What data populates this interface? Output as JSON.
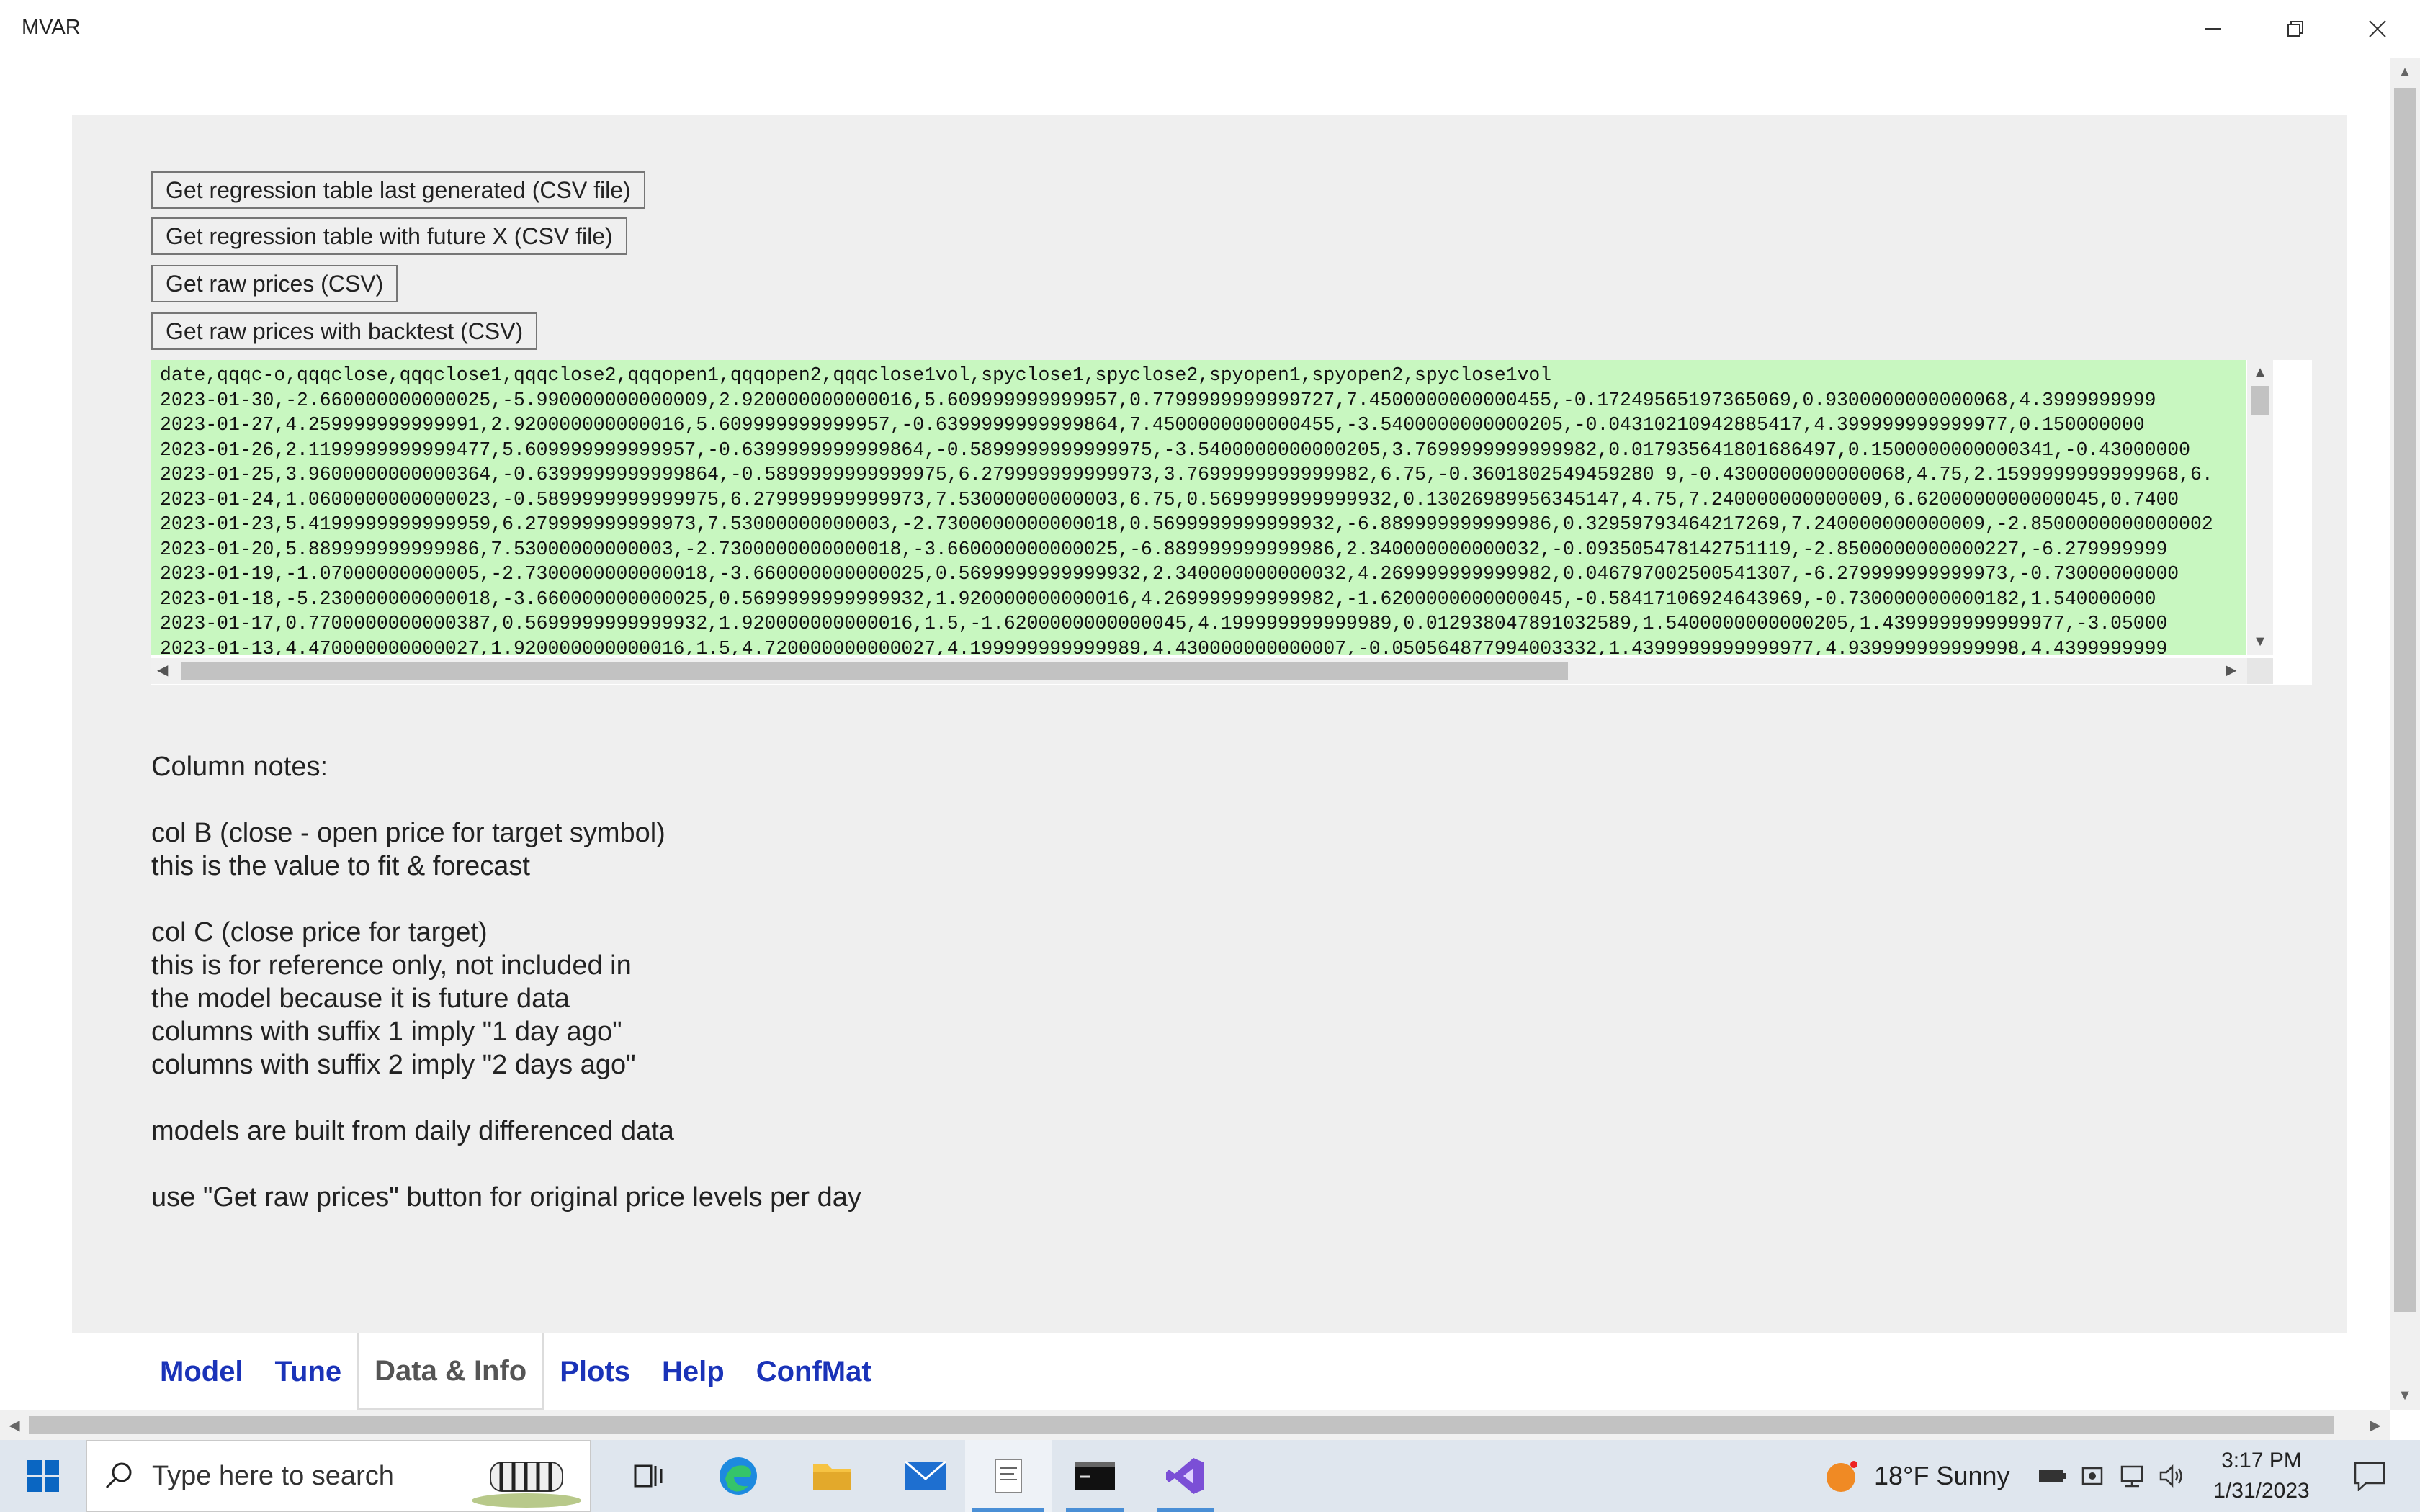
{
  "window": {
    "title": "MVAR"
  },
  "buttons": {
    "regression_last": "Get regression table last generated (CSV file)",
    "regression_future": "Get regression table with future X (CSV file)",
    "raw_prices": "Get raw prices (CSV)",
    "raw_prices_backtest": "Get raw prices with backtest (CSV)"
  },
  "csv": {
    "lines": [
      "date,qqqc-o,qqqclose,qqqclose1,qqqclose2,qqqopen1,qqqopen2,qqqclose1vol,spyclose1,spyclose2,spyopen1,spyopen2,spyclose1vol",
      "2023-01-30,-2.660000000000025,-5.990000000000009,2.920000000000016,5.609999999999957,0.7799999999999727,7.4500000000000455,-0.17249565197365069,0.9300000000000068,4.3999999999",
      "2023-01-27,4.259999999999991,2.920000000000016,5.609999999999957,-0.6399999999999864,7.4500000000000455,-3.5400000000000205,-0.04310210942885417,4.399999999999977,0.150000000",
      "2023-01-26,2.1199999999999477,5.609999999999957,-0.6399999999999864,-0.5899999999999975,-3.5400000000000205,3.7699999999999982,0.017935641801686497,0.1500000000000341,-0.43000000",
      "2023-01-25,3.9600000000000364,-0.6399999999999864,-0.5899999999999975,6.279999999999973,3.7699999999999982,6.75,-0.3601802549459280 9,-0.4300000000000068,4.75,2.1599999999999968,6.",
      "2023-01-24,1.0600000000000023,-0.5899999999999975,6.279999999999973,7.53000000000003,6.75,0.5699999999999932,0.13026989956345147,4.75,7.240000000000009,6.6200000000000045,0.7400",
      "2023-01-23,5.4199999999999959,6.279999999999973,7.53000000000003,-2.7300000000000018,0.5699999999999932,-6.889999999999986,0.32959793464217269,7.240000000000009,-2.8500000000000002",
      "2023-01-20,5.889999999999986,7.53000000000003,-2.7300000000000018,-3.660000000000025,-6.889999999999986,2.340000000000032,-0.093505478142751119,-2.8500000000000227,-6.279999999",
      "2023-01-19,-1.07000000000005,-2.7300000000000018,-3.660000000000025,0.5699999999999932,2.340000000000032,4.269999999999982,0.046797002500541307,-6.279999999999973,-0.73000000000",
      "2023-01-18,-5.230000000000018,-3.660000000000025,0.5699999999999932,1.920000000000016,4.269999999999982,-1.6200000000000045,-0.58417106924643969,-0.730000000000182,1.540000000",
      "2023-01-17,0.7700000000000387,0.5699999999999932,1.920000000000016,1.5,-1.6200000000000045,4.199999999999989,0.012938047891032589,1.5400000000000205,1.4399999999999977,-3.05000",
      "2023-01-13,4.470000000000027,1.920000000000016,1.5,4.720000000000027,4.199999999999989,4.430000000000007,-0.050564877994003332,1.4399999999999977,4.939999999999998,4.4399999999",
      "2023-01-12,0.9300000000000068,1.5,4.720000000000027,2.2899999999999636,4.430000000000007,-1.339999999999975,0.063691206469515649,4.939999999999998,2.7199999999999704,4.98000000"
    ]
  },
  "notes": {
    "lines": [
      "Column notes:",
      "",
      "col B (close - open price for target symbol)",
      "this is the value to fit & forecast",
      "",
      "col C (close price for target)",
      "this is for reference only, not included in",
      "the model because it is future data",
      "columns with suffix 1 imply \"1 day ago\"",
      "columns with suffix 2 imply \"2 days ago\"",
      "",
      "models are built from daily differenced data",
      "",
      "use \"Get raw prices\" button for original price levels per day"
    ]
  },
  "tabs": [
    {
      "label": "Model",
      "active": false
    },
    {
      "label": "Tune",
      "active": false
    },
    {
      "label": "Data & Info",
      "active": true
    },
    {
      "label": "Plots",
      "active": false
    },
    {
      "label": "Help",
      "active": false
    },
    {
      "label": "ConfMat",
      "active": false
    }
  ],
  "taskbar": {
    "search_placeholder": "Type here to search",
    "weather": "18°F  Sunny",
    "time": "3:17 PM",
    "date": "1/31/2023"
  },
  "colors": {
    "csv_background": "#c8f7c0",
    "tab_link": "#1a33b8",
    "panel": "#efefef",
    "taskbar": "#dfe6ee"
  }
}
